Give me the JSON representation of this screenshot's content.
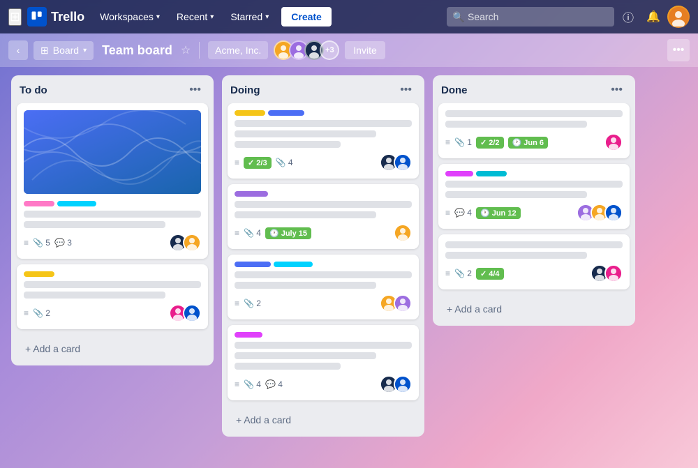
{
  "nav": {
    "logo_text": "Trello",
    "workspaces_label": "Workspaces",
    "recent_label": "Recent",
    "starred_label": "Starred",
    "create_label": "Create",
    "search_placeholder": "Search"
  },
  "board_bar": {
    "view_label": "Board",
    "board_title": "Team board",
    "workspace_label": "Acme, Inc.",
    "members_extra": "+3",
    "invite_label": "Invite"
  },
  "columns": [
    {
      "id": "todo",
      "title": "To do",
      "cards": [
        {
          "id": "c1",
          "has_cover": true,
          "labels": [
            "pink",
            "cyan"
          ],
          "lines": [
            "full",
            "medium"
          ],
          "meta_hamburger": true,
          "attach": "5",
          "comment": "3",
          "avatars": [
            "dark",
            "orange"
          ]
        },
        {
          "id": "c2",
          "labels": [
            "yellow"
          ],
          "lines": [
            "full",
            "medium"
          ],
          "meta_hamburger": true,
          "attach": "2",
          "avatars": [
            "pink",
            "blue"
          ]
        }
      ],
      "add_card_label": "+ Add a card"
    },
    {
      "id": "doing",
      "title": "Doing",
      "cards": [
        {
          "id": "c3",
          "labels": [
            "yellow",
            "blue"
          ],
          "lines": [
            "full",
            "medium",
            "short"
          ],
          "meta_hamburger": true,
          "check": "2/3",
          "attach": "4",
          "avatars": [
            "dark",
            "blue"
          ]
        },
        {
          "id": "c4",
          "labels": [
            "purple"
          ],
          "lines": [
            "full",
            "medium"
          ],
          "meta_hamburger": true,
          "attach": "4",
          "due": "July 15",
          "avatars": [
            "orange"
          ]
        },
        {
          "id": "c5",
          "labels": [
            "blue",
            "cyan"
          ],
          "lines": [
            "full",
            "medium"
          ],
          "meta_hamburger": true,
          "attach": "2",
          "avatars": [
            "orange",
            "purple"
          ]
        },
        {
          "id": "c6",
          "labels": [
            "magenta"
          ],
          "lines": [
            "full",
            "medium",
            "short"
          ],
          "meta_hamburger": true,
          "attach": "4",
          "comment": "4",
          "avatars": [
            "dark",
            "blue"
          ]
        }
      ],
      "add_card_label": "+ Add a card"
    },
    {
      "id": "done",
      "title": "Done",
      "cards": [
        {
          "id": "c7",
          "lines": [
            "full",
            "medium"
          ],
          "meta_hamburger": true,
          "attach": "1",
          "check_badge": "2/2",
          "due_badge": "Jun 6",
          "avatars": [
            "pink"
          ]
        },
        {
          "id": "c8",
          "labels": [
            "magenta",
            "teal"
          ],
          "lines": [
            "full",
            "medium"
          ],
          "meta_hamburger": true,
          "comment": "4",
          "due_badge2": "Jun 12",
          "avatars": [
            "purple",
            "orange",
            "blue"
          ]
        },
        {
          "id": "c9",
          "lines": [
            "full",
            "medium"
          ],
          "meta_hamburger": true,
          "attach": "2",
          "check_badge": "4/4",
          "avatars": [
            "dark",
            "pink"
          ]
        }
      ],
      "add_card_label": "+ Add a card"
    }
  ]
}
